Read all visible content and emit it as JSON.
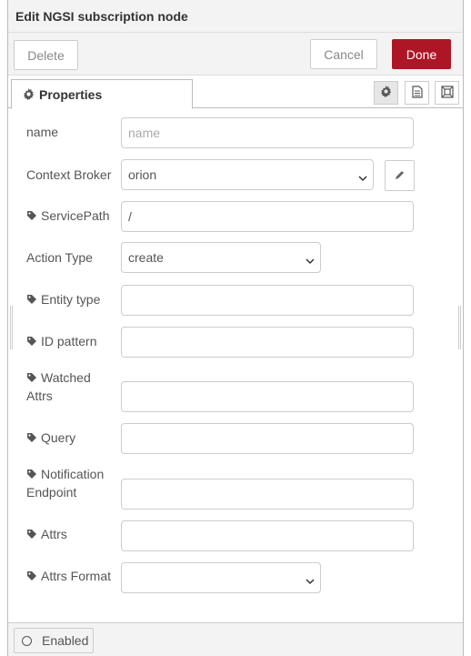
{
  "title": "Edit NGSI subscription node",
  "toolbar": {
    "delete_label": "Delete",
    "cancel_label": "Cancel",
    "done_label": "Done"
  },
  "tabs": {
    "properties_label": "Properties"
  },
  "form": {
    "name": {
      "label": "name",
      "value": "",
      "placeholder": "name"
    },
    "context_broker": {
      "label": "Context Broker",
      "value": "orion"
    },
    "service_path": {
      "label": "ServicePath",
      "value": "/"
    },
    "action_type": {
      "label": "Action Type",
      "value": "create"
    },
    "entity_type": {
      "label": "Entity type",
      "value": ""
    },
    "id_pattern": {
      "label": "ID pattern",
      "value": ""
    },
    "watched_attrs": {
      "label_line1": "Watched",
      "label_line2": "Attrs",
      "value": ""
    },
    "query": {
      "label": "Query",
      "value": ""
    },
    "notification_endpoint": {
      "label_line1": "Notification",
      "label_line2": "Endpoint",
      "value": ""
    },
    "attrs": {
      "label": "Attrs",
      "value": ""
    },
    "attrs_format": {
      "label": "Attrs Format",
      "value": ""
    }
  },
  "footer": {
    "enabled_label": "Enabled"
  },
  "colors": {
    "done": "#ad1625",
    "panel": "#f3f3f3",
    "border": "#cccccc"
  },
  "icons": [
    "gear-icon",
    "description-icon",
    "expand-icon",
    "tag-icon",
    "pencil-icon",
    "chevron-down-icon",
    "circle-icon"
  ]
}
